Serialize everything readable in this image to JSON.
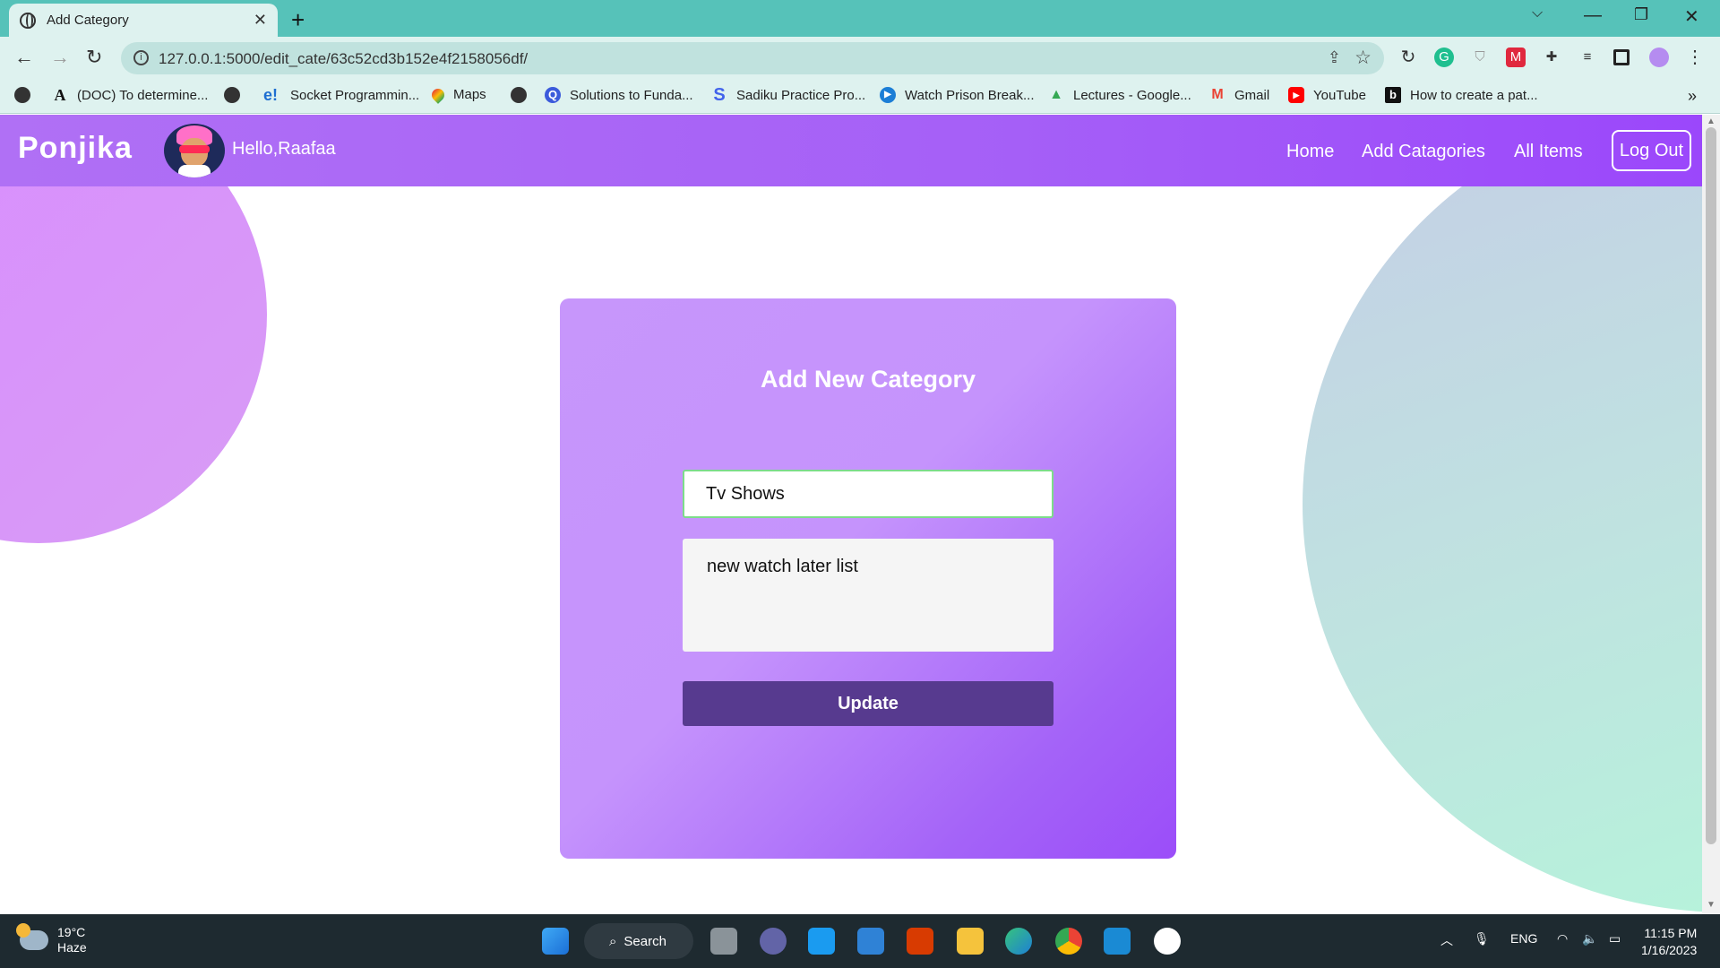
{
  "browser": {
    "tab_title": "Add Category",
    "new_tab_symbol": "+",
    "url": "127.0.0.1:5000/edit_cate/63c52cd3b152e4f2158056df/",
    "bookmarks": [
      {
        "label": "(DOC) To determine...",
        "icon": "academia-icon"
      },
      {
        "label": "Socket Programmin...",
        "icon": "e-icon"
      },
      {
        "label": "Maps",
        "icon": "maps-pin-icon"
      },
      {
        "label": "Solutions to Funda...",
        "icon": "q-icon"
      },
      {
        "label": "Sadiku Practice Pro...",
        "icon": "s-icon"
      },
      {
        "label": "Watch Prison Break...",
        "icon": "play-icon"
      },
      {
        "label": "Lectures - Google...",
        "icon": "drive-icon"
      },
      {
        "label": "Gmail",
        "icon": "gmail-icon"
      },
      {
        "label": "YouTube",
        "icon": "youtube-icon"
      },
      {
        "label": "How to create a pat...",
        "icon": "b-icon"
      }
    ],
    "more_bookmarks": "»"
  },
  "site": {
    "logo": "Ponjika",
    "greeting": "Hello,Raafaa",
    "nav": {
      "home": "Home",
      "add_categories": "Add Catagories",
      "all_items": "All Items",
      "logout": "Log Out"
    }
  },
  "form": {
    "title": "Add New Category",
    "name_value": "Tv Shows",
    "description_value": "new watch later list",
    "submit_label": "Update"
  },
  "taskbar": {
    "weather_temp": "19°C",
    "weather_desc": "Haze",
    "search_label": "Search",
    "language": "ENG",
    "time": "11:15 PM",
    "date": "1/16/2023"
  },
  "colors": {
    "navbar": "#a55ff7",
    "card_start": "#c796fb",
    "card_end": "#9b4df9",
    "button": "#573a8f",
    "input_border": "#7ddc8a",
    "chrome_frame": "#56c2b9"
  }
}
